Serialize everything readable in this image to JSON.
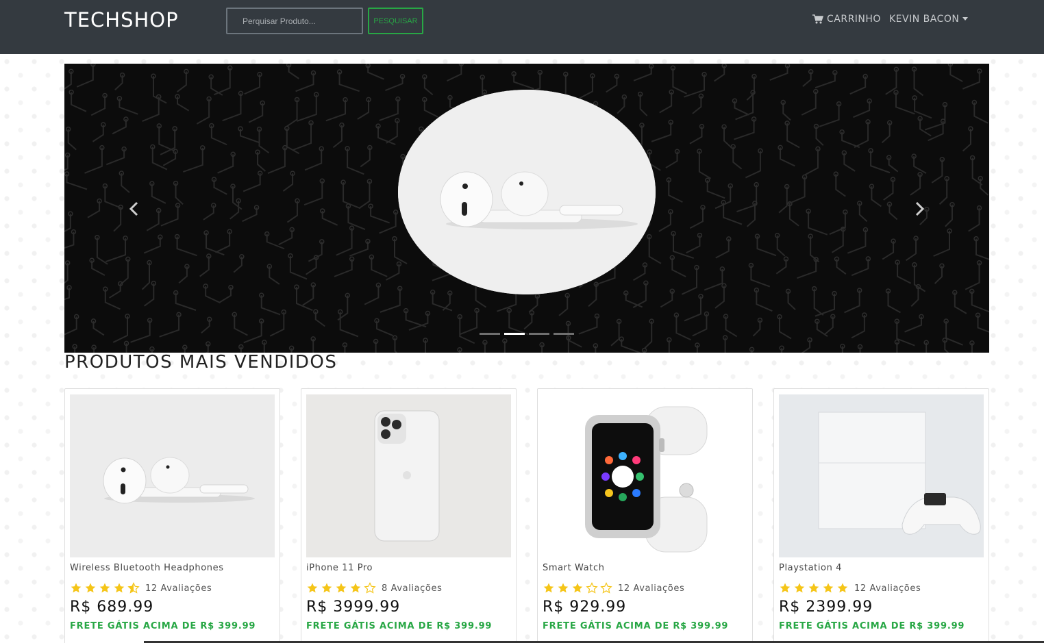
{
  "header": {
    "brand": "TECHSHOP",
    "search_placeholder": "Perquisar Produto...",
    "search_button": "PESQUISAR",
    "cart_label": "CARRINHO",
    "user_label": "KEVIN BACON"
  },
  "carousel": {
    "active_index": 1,
    "slide_count": 4
  },
  "section": {
    "title": "PRODUTOS MAIS VENDIDOS"
  },
  "products": [
    {
      "name": "Wireless Bluetooth Headphones",
      "rating": 4.5,
      "reviews": "12 Avaliações",
      "price": "R$ 689.99",
      "shipping": "FRETE GÁTIS ACIMA DE R$ 399.99",
      "image": "earbuds"
    },
    {
      "name": "iPhone 11 Pro",
      "rating": 4,
      "reviews": "8 Avaliações",
      "price": "R$ 3999.99",
      "shipping": "FRETE GÁTIS ACIMA DE R$ 399.99",
      "image": "phone"
    },
    {
      "name": "Smart Watch",
      "rating": 3,
      "reviews": "12 Avaliações",
      "price": "R$ 929.99",
      "shipping": "FRETE GÁTIS ACIMA DE R$ 399.99",
      "image": "watch"
    },
    {
      "name": "Playstation 4",
      "rating": 5,
      "reviews": "12 Avaliações",
      "price": "R$ 2399.99",
      "shipping": "FRETE GÁTIS ACIMA DE R$ 399.99",
      "image": "console"
    }
  ],
  "colors": {
    "navbar": "#343a40",
    "accent": "#28a745",
    "star": "#f5c518"
  }
}
